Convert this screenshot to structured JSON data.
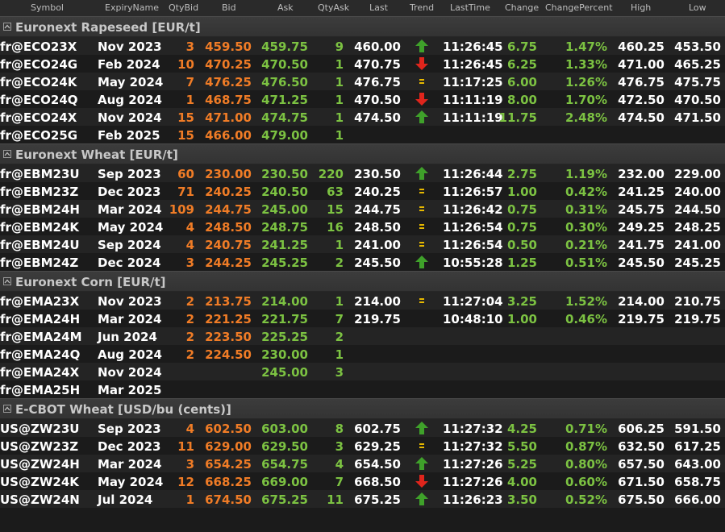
{
  "columns": [
    "Symbol",
    "ExpiryName",
    "QtyBid",
    "Bid",
    "Ask",
    "QtyAsk",
    "Last",
    "Trend",
    "LastTime",
    "Change",
    "ChangePercent",
    "High",
    "Low"
  ],
  "colors": {
    "bid": "#f07c26",
    "ask": "#7cc242",
    "up": "#3fa12a",
    "down": "#e0251c",
    "eq": "#e6b800"
  },
  "groups": [
    {
      "title": "Euronext Rapeseed [EUR/t]",
      "rows": [
        {
          "symbol": "fr@ECO23X",
          "expiry": "Nov 2023",
          "qtybid": "3",
          "bid": "459.50",
          "ask": "459.75",
          "qtyask": "9",
          "last": "460.00",
          "trend": "up",
          "lasttime": "11:26:45",
          "change": "6.75",
          "changep": "1.47%",
          "high": "460.25",
          "low": "453.50"
        },
        {
          "symbol": "fr@ECO24G",
          "expiry": "Feb 2024",
          "qtybid": "10",
          "bid": "470.25",
          "ask": "470.50",
          "qtyask": "1",
          "last": "470.75",
          "trend": "down",
          "lasttime": "11:26:45",
          "change": "6.25",
          "changep": "1.33%",
          "high": "471.00",
          "low": "465.25"
        },
        {
          "symbol": "fr@ECO24K",
          "expiry": "May 2024",
          "qtybid": "7",
          "bid": "476.25",
          "ask": "476.50",
          "qtyask": "1",
          "last": "476.75",
          "trend": "eq",
          "lasttime": "11:17:25",
          "change": "6.00",
          "changep": "1.26%",
          "high": "476.75",
          "low": "475.75"
        },
        {
          "symbol": "fr@ECO24Q",
          "expiry": "Aug 2024",
          "qtybid": "1",
          "bid": "468.75",
          "ask": "471.25",
          "qtyask": "1",
          "last": "470.50",
          "trend": "down",
          "lasttime": "11:11:19",
          "change": "8.00",
          "changep": "1.70%",
          "high": "472.50",
          "low": "470.50"
        },
        {
          "symbol": "fr@ECO24X",
          "expiry": "Nov 2024",
          "qtybid": "15",
          "bid": "471.00",
          "ask": "474.75",
          "qtyask": "1",
          "last": "474.50",
          "trend": "up",
          "lasttime": "11:11:19",
          "change": "11.75",
          "changep": "2.48%",
          "high": "474.50",
          "low": "471.50"
        },
        {
          "symbol": "fr@ECO25G",
          "expiry": "Feb 2025",
          "qtybid": "15",
          "bid": "466.00",
          "ask": "479.00",
          "qtyask": "1",
          "last": "",
          "trend": "",
          "lasttime": "",
          "change": "",
          "changep": "",
          "high": "",
          "low": ""
        }
      ]
    },
    {
      "title": "Euronext Wheat [EUR/t]",
      "rows": [
        {
          "symbol": "fr@EBM23U",
          "expiry": "Sep 2023",
          "qtybid": "60",
          "bid": "230.00",
          "ask": "230.50",
          "qtyask": "220",
          "last": "230.50",
          "trend": "up",
          "lasttime": "11:26:44",
          "change": "2.75",
          "changep": "1.19%",
          "high": "232.00",
          "low": "229.00"
        },
        {
          "symbol": "fr@EBM23Z",
          "expiry": "Dec 2023",
          "qtybid": "71",
          "bid": "240.25",
          "ask": "240.50",
          "qtyask": "63",
          "last": "240.25",
          "trend": "eq",
          "lasttime": "11:26:57",
          "change": "1.00",
          "changep": "0.42%",
          "high": "241.25",
          "low": "240.00"
        },
        {
          "symbol": "fr@EBM24H",
          "expiry": "Mar 2024",
          "qtybid": "109",
          "bid": "244.75",
          "ask": "245.00",
          "qtyask": "15",
          "last": "244.75",
          "trend": "eq",
          "lasttime": "11:26:42",
          "change": "0.75",
          "changep": "0.31%",
          "high": "245.75",
          "low": "244.50"
        },
        {
          "symbol": "fr@EBM24K",
          "expiry": "May 2024",
          "qtybid": "4",
          "bid": "248.50",
          "ask": "248.75",
          "qtyask": "16",
          "last": "248.50",
          "trend": "eq",
          "lasttime": "11:26:54",
          "change": "0.75",
          "changep": "0.30%",
          "high": "249.25",
          "low": "248.25"
        },
        {
          "symbol": "fr@EBM24U",
          "expiry": "Sep 2024",
          "qtybid": "4",
          "bid": "240.75",
          "ask": "241.25",
          "qtyask": "1",
          "last": "241.00",
          "trend": "eq",
          "lasttime": "11:26:54",
          "change": "0.50",
          "changep": "0.21%",
          "high": "241.75",
          "low": "241.00"
        },
        {
          "symbol": "fr@EBM24Z",
          "expiry": "Dec 2024",
          "qtybid": "3",
          "bid": "244.25",
          "ask": "245.25",
          "qtyask": "2",
          "last": "245.50",
          "trend": "up",
          "lasttime": "10:55:28",
          "change": "1.25",
          "changep": "0.51%",
          "high": "245.50",
          "low": "245.25"
        }
      ]
    },
    {
      "title": "Euronext Corn [EUR/t]",
      "rows": [
        {
          "symbol": "fr@EMA23X",
          "expiry": "Nov 2023",
          "qtybid": "2",
          "bid": "213.75",
          "ask": "214.00",
          "qtyask": "1",
          "last": "214.00",
          "trend": "eq",
          "lasttime": "11:27:04",
          "change": "3.25",
          "changep": "1.52%",
          "high": "214.00",
          "low": "210.75"
        },
        {
          "symbol": "fr@EMA24H",
          "expiry": "Mar 2024",
          "qtybid": "2",
          "bid": "221.25",
          "ask": "221.75",
          "qtyask": "7",
          "last": "219.75",
          "trend": "",
          "lasttime": "10:48:10",
          "change": "1.00",
          "changep": "0.46%",
          "high": "219.75",
          "low": "219.75"
        },
        {
          "symbol": "fr@EMA24M",
          "expiry": "Jun 2024",
          "qtybid": "2",
          "bid": "223.50",
          "ask": "225.25",
          "qtyask": "2",
          "last": "",
          "trend": "",
          "lasttime": "",
          "change": "",
          "changep": "",
          "high": "",
          "low": ""
        },
        {
          "symbol": "fr@EMA24Q",
          "expiry": "Aug 2024",
          "qtybid": "2",
          "bid": "224.50",
          "ask": "230.00",
          "qtyask": "1",
          "last": "",
          "trend": "",
          "lasttime": "",
          "change": "",
          "changep": "",
          "high": "",
          "low": ""
        },
        {
          "symbol": "fr@EMA24X",
          "expiry": "Nov 2024",
          "qtybid": "",
          "bid": "",
          "ask": "245.00",
          "qtyask": "3",
          "last": "",
          "trend": "",
          "lasttime": "",
          "change": "",
          "changep": "",
          "high": "",
          "low": ""
        },
        {
          "symbol": "fr@EMA25H",
          "expiry": "Mar 2025",
          "qtybid": "",
          "bid": "",
          "ask": "",
          "qtyask": "",
          "last": "",
          "trend": "",
          "lasttime": "",
          "change": "",
          "changep": "",
          "high": "",
          "low": ""
        }
      ]
    },
    {
      "title": "E-CBOT Wheat [USD/bu (cents)]",
      "rows": [
        {
          "symbol": "US@ZW23U",
          "expiry": "Sep 2023",
          "qtybid": "4",
          "bid": "602.50",
          "ask": "603.00",
          "qtyask": "8",
          "last": "602.75",
          "trend": "up",
          "lasttime": "11:27:32",
          "change": "4.25",
          "changep": "0.71%",
          "high": "606.25",
          "low": "591.50"
        },
        {
          "symbol": "US@ZW23Z",
          "expiry": "Dec 2023",
          "qtybid": "11",
          "bid": "629.00",
          "ask": "629.50",
          "qtyask": "3",
          "last": "629.25",
          "trend": "eq",
          "lasttime": "11:27:32",
          "change": "5.50",
          "changep": "0.87%",
          "high": "632.50",
          "low": "617.25"
        },
        {
          "symbol": "US@ZW24H",
          "expiry": "Mar 2024",
          "qtybid": "3",
          "bid": "654.25",
          "ask": "654.75",
          "qtyask": "4",
          "last": "654.50",
          "trend": "up",
          "lasttime": "11:27:26",
          "change": "5.25",
          "changep": "0.80%",
          "high": "657.50",
          "low": "643.00"
        },
        {
          "symbol": "US@ZW24K",
          "expiry": "May 2024",
          "qtybid": "12",
          "bid": "668.25",
          "ask": "669.00",
          "qtyask": "7",
          "last": "668.50",
          "trend": "down",
          "lasttime": "11:27:26",
          "change": "4.00",
          "changep": "0.60%",
          "high": "671.50",
          "low": "658.75"
        },
        {
          "symbol": "US@ZW24N",
          "expiry": "Jul 2024",
          "qtybid": "1",
          "bid": "674.50",
          "ask": "675.25",
          "qtyask": "11",
          "last": "675.25",
          "trend": "up",
          "lasttime": "11:26:23",
          "change": "3.50",
          "changep": "0.52%",
          "high": "675.50",
          "low": "666.00"
        }
      ]
    }
  ]
}
